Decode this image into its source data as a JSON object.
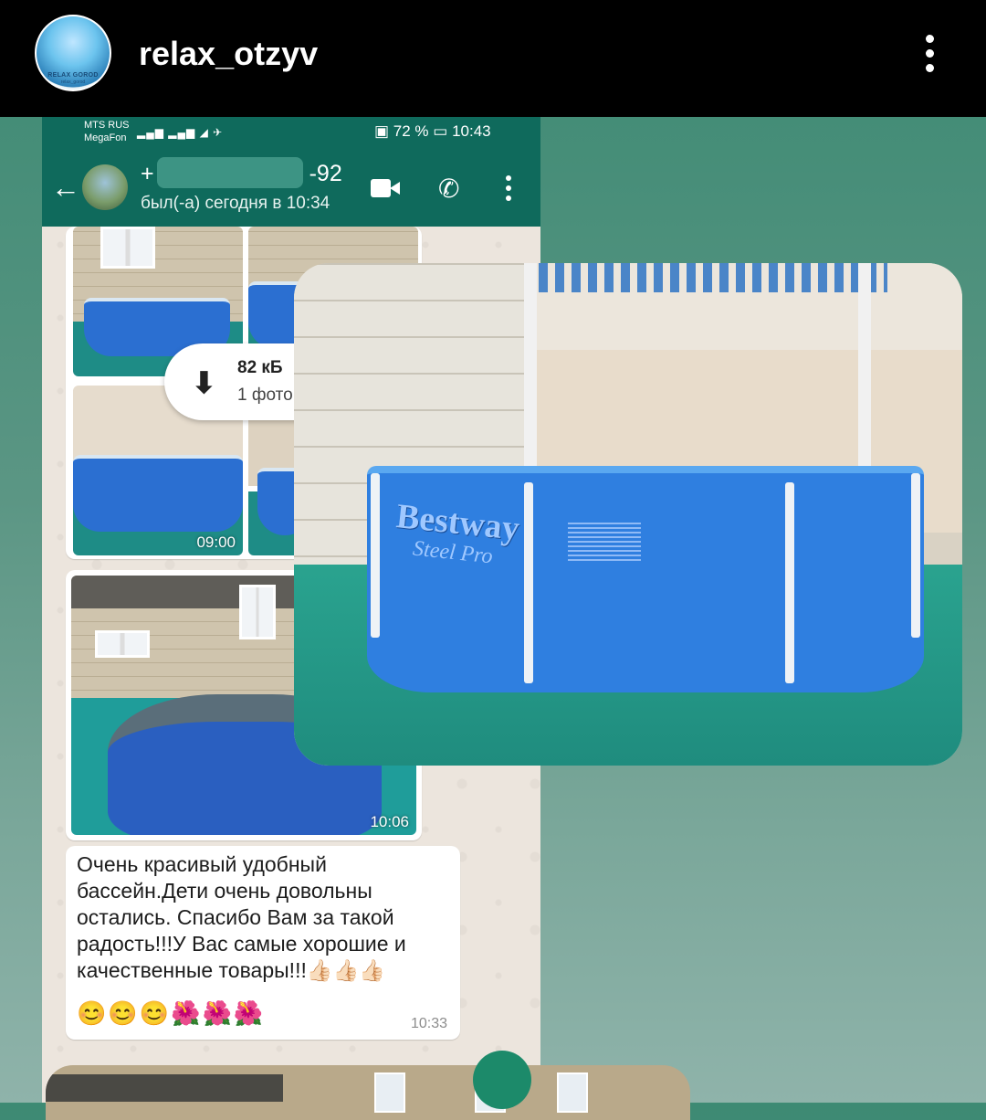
{
  "story": {
    "username": "relax_otzyv",
    "avatar_brand": "RELAX GOROD",
    "avatar_sub": "relax_gorod"
  },
  "phone_status": {
    "carrier1": "MTS RUS",
    "carrier2": "MegaFon",
    "network": "4G",
    "battery": "72 %",
    "time": "10:43"
  },
  "chat_header": {
    "contact_prefix": "+",
    "contact_suffix": "-92",
    "last_seen": "был(-а) сегодня в 10:34"
  },
  "messages": {
    "album_time": "09:00",
    "download": {
      "size": "82 кБ",
      "count": "1 фото"
    },
    "photo2_time": "10:06",
    "text": "Очень красивый удобный бассейн.Дети очень довольны остались. Спасибо Вам за такой радость!!!У Вас самые хорошие и качественные товары!!!👍🏻👍🏻👍🏻",
    "emojis": "😊😊😊🌺🌺🌺",
    "text_time": "10:33"
  },
  "overlay_photo": {
    "brand": "Bestway",
    "model": "Steel Pro"
  }
}
